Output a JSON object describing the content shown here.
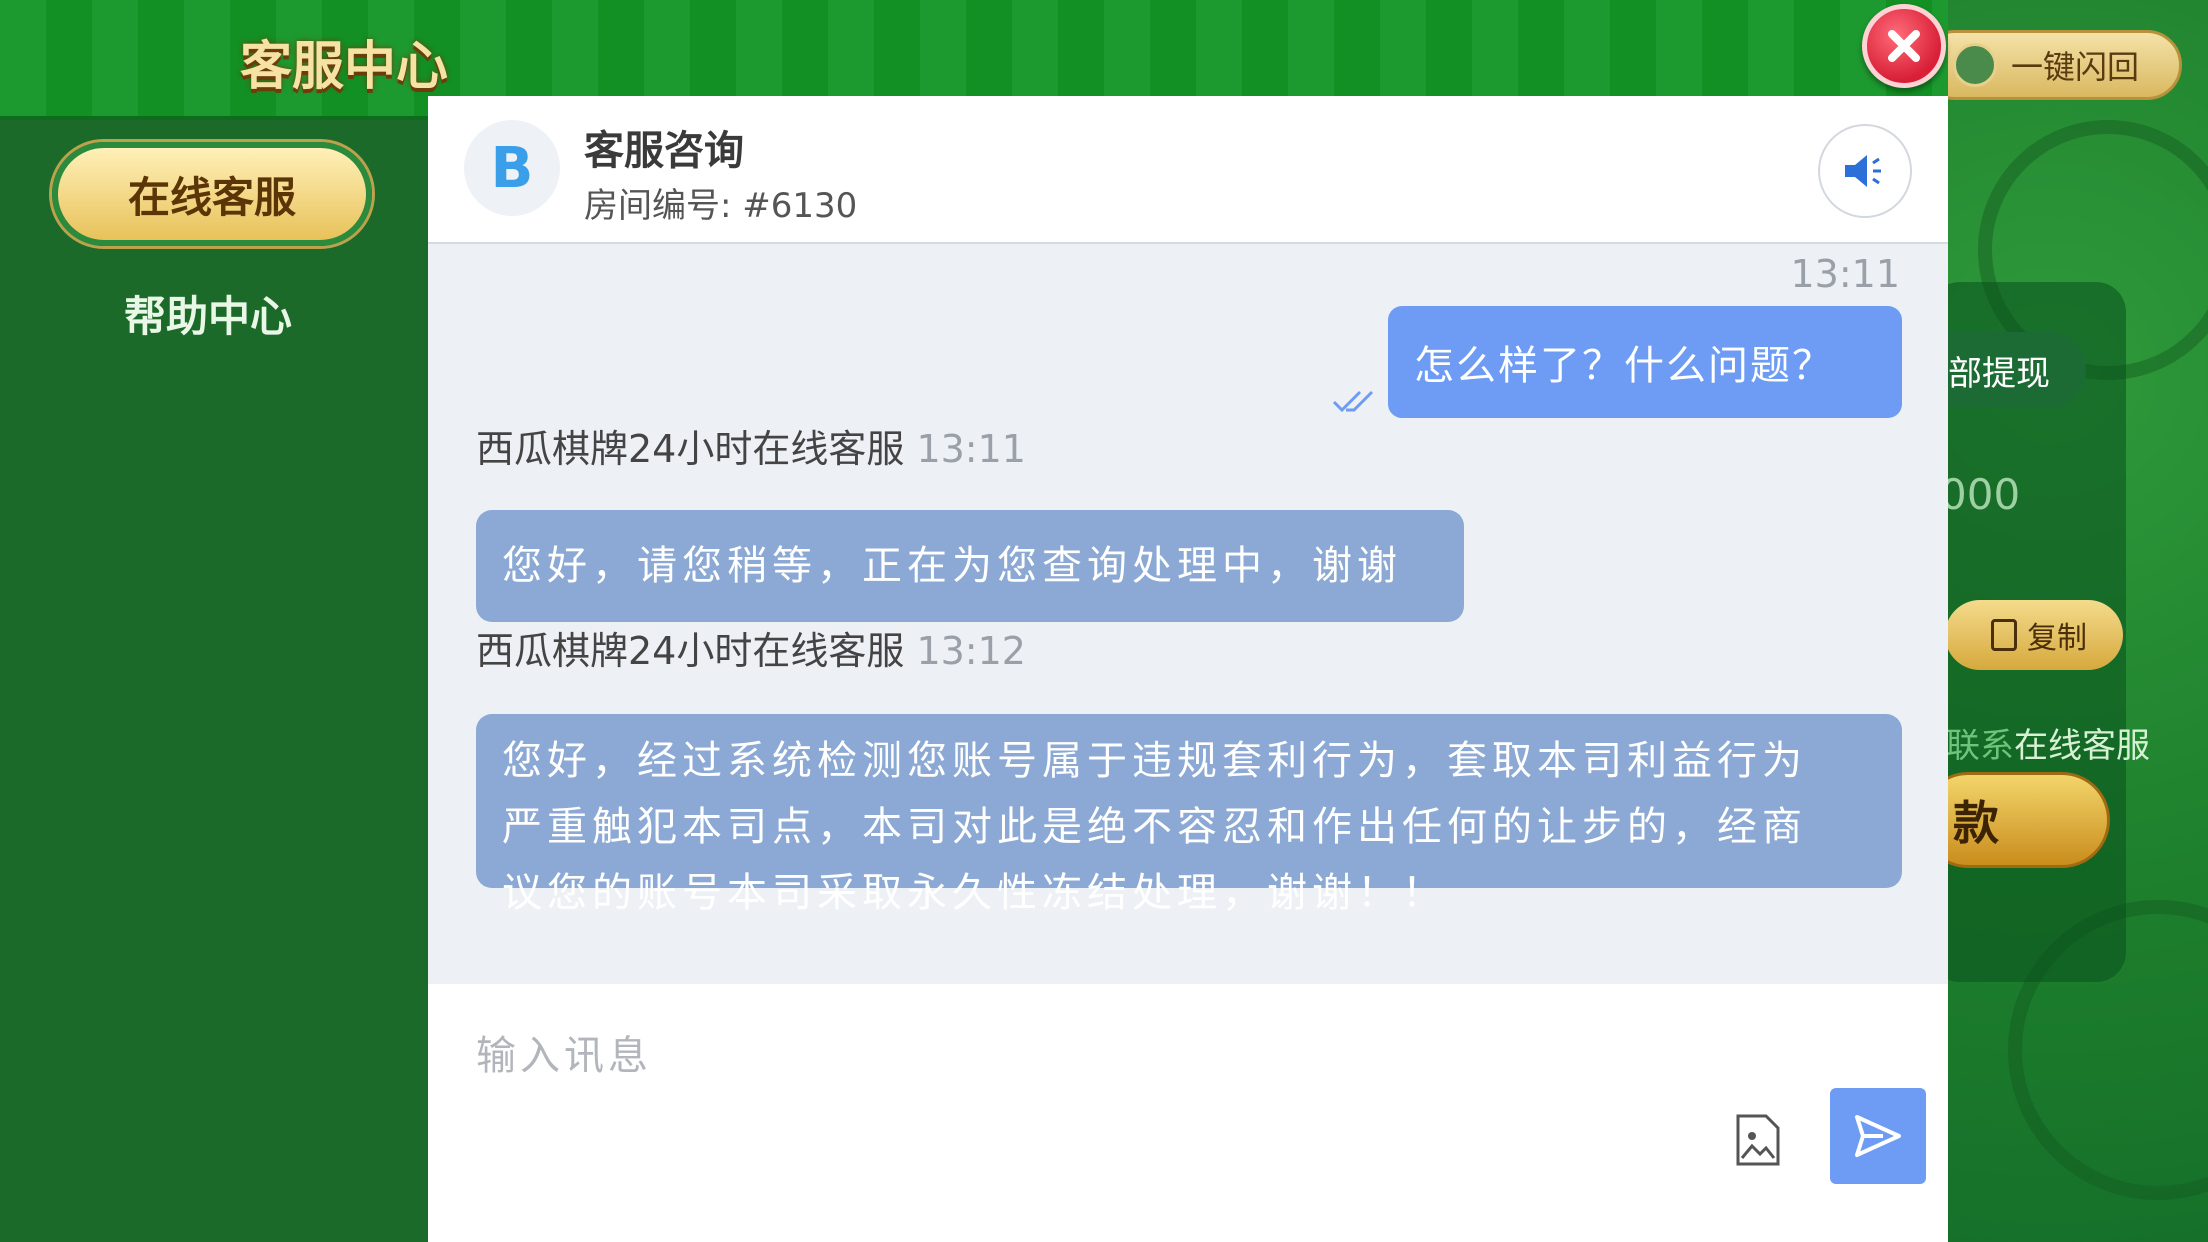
{
  "header": {
    "title": "客服中心"
  },
  "sidebar": {
    "items": [
      {
        "label": "在线客服",
        "active": true
      },
      {
        "label": "帮助中心",
        "active": false
      }
    ]
  },
  "chat": {
    "title": "客服咨询",
    "room": "房间编号: #6130",
    "avatar_icon": "chat-logo-icon",
    "messages": [
      {
        "from": "user",
        "time": "13:11",
        "text": "怎么样了？什么问题？"
      },
      {
        "from": "agent",
        "sender": "西瓜棋牌24小时在线客服",
        "time": "13:11",
        "text": "您好，请您稍等，正在为您查询处理中，谢谢"
      },
      {
        "from": "agent",
        "sender": "西瓜棋牌24小时在线客服",
        "time": "13:12",
        "lines": [
          "您好，经过系统检测您账号属于违规套利行为，套取本司利益行为",
          "严重触犯本司点，本司对此是绝不容忍和作出任何的让步的，经商",
          "议您的账号本司采取永久性冻结处理，谢谢！！"
        ]
      }
    ],
    "input_placeholder": "输入讯息"
  },
  "background": {
    "return_button": "一键闪回",
    "withdraw_fragment": "部提现",
    "amount_fragment": "000",
    "copy_button": "复制",
    "contact_prefix": "联系",
    "contact_suffix": "在线客服",
    "deposit_fragment": "款"
  },
  "colors": {
    "accent_blue": "#6e9cf5",
    "agent_bubble": "#8ba9d4",
    "sidebar_green": "#1c6a2a",
    "close_red": "#d81f36"
  }
}
